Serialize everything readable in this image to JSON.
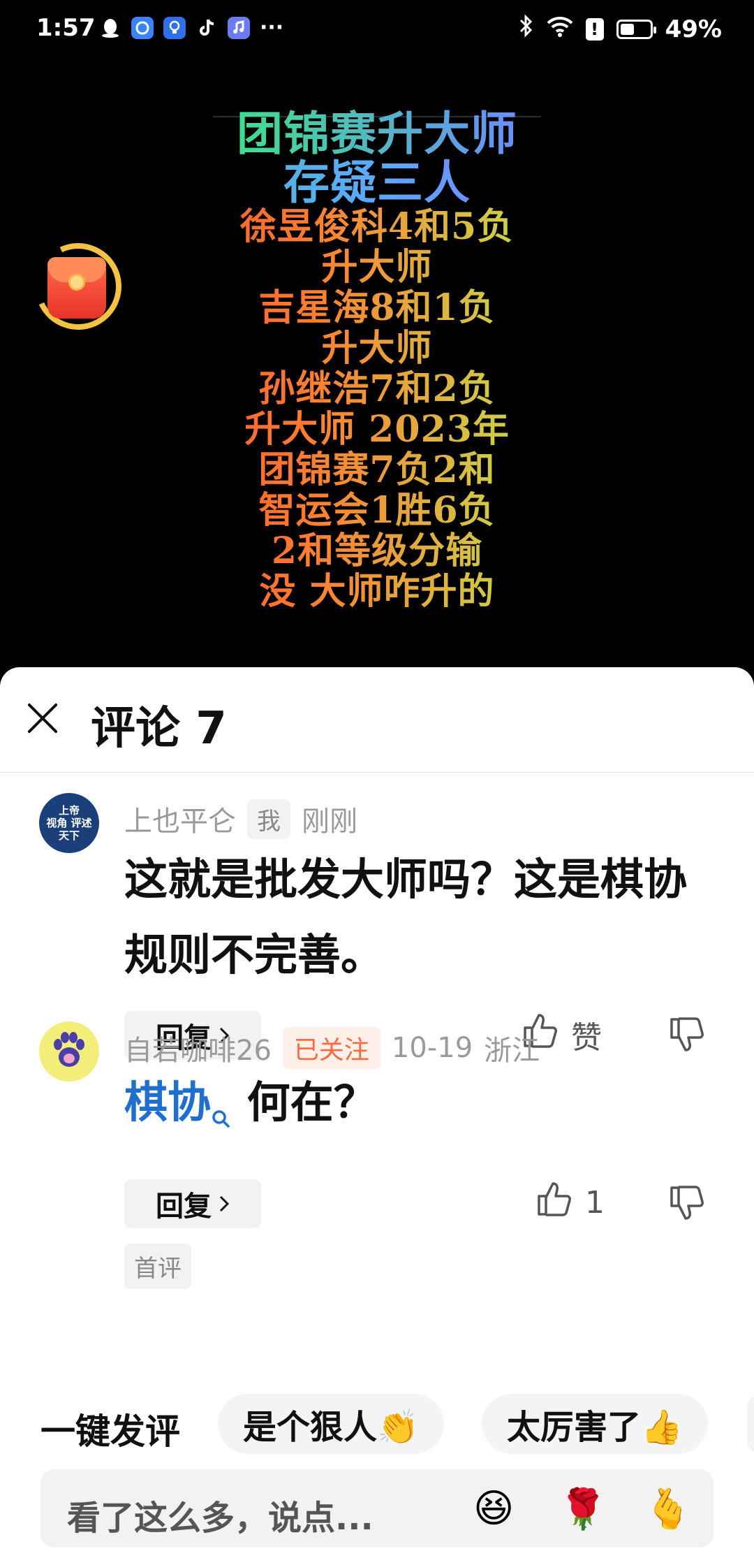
{
  "status_bar": {
    "time": "1:57",
    "left_icons": [
      "qq-icon",
      "browser-icon",
      "bulb-icon",
      "tiktok-icon",
      "music-icon"
    ],
    "more": "···",
    "battery_percent": "49%",
    "battery_level": 0.49
  },
  "video": {
    "title_line1": "团锦赛升大师",
    "title_line2": "存疑三人",
    "lines": [
      "徐昱俊科4和5负",
      "升大师",
      "吉星海8和1负",
      "升大师",
      "孙继浩7和2负",
      "升大师 2023年",
      "团锦赛7负2和",
      "智运会1胜6负",
      "2和等级分输",
      "没 大师咋升的"
    ]
  },
  "sheet": {
    "title": "评论 7"
  },
  "comments": [
    {
      "avatar_text": "上帝\n视角 评述\n天下",
      "username": "上也平仑",
      "tag": "我",
      "time": "刚刚",
      "text": "这就是批发大师吗？这是棋协规则不完善。",
      "reply_label": "回复",
      "like_label": "赞"
    },
    {
      "username": "自若咖啡26",
      "tag": "已关注",
      "time": "10-19",
      "location": "浙江",
      "link_word": "棋协",
      "text_rest": "何在？",
      "reply_label": "回复",
      "like_count": "1",
      "badge": "首评"
    }
  ],
  "quick_reply": {
    "label": "一键发评",
    "chips": [
      "是个狠人👏",
      "太厉害了👍"
    ]
  },
  "input": {
    "placeholder": "看了这么多，说点...",
    "emojis": [
      "😆",
      "🌹",
      "🫰"
    ]
  }
}
